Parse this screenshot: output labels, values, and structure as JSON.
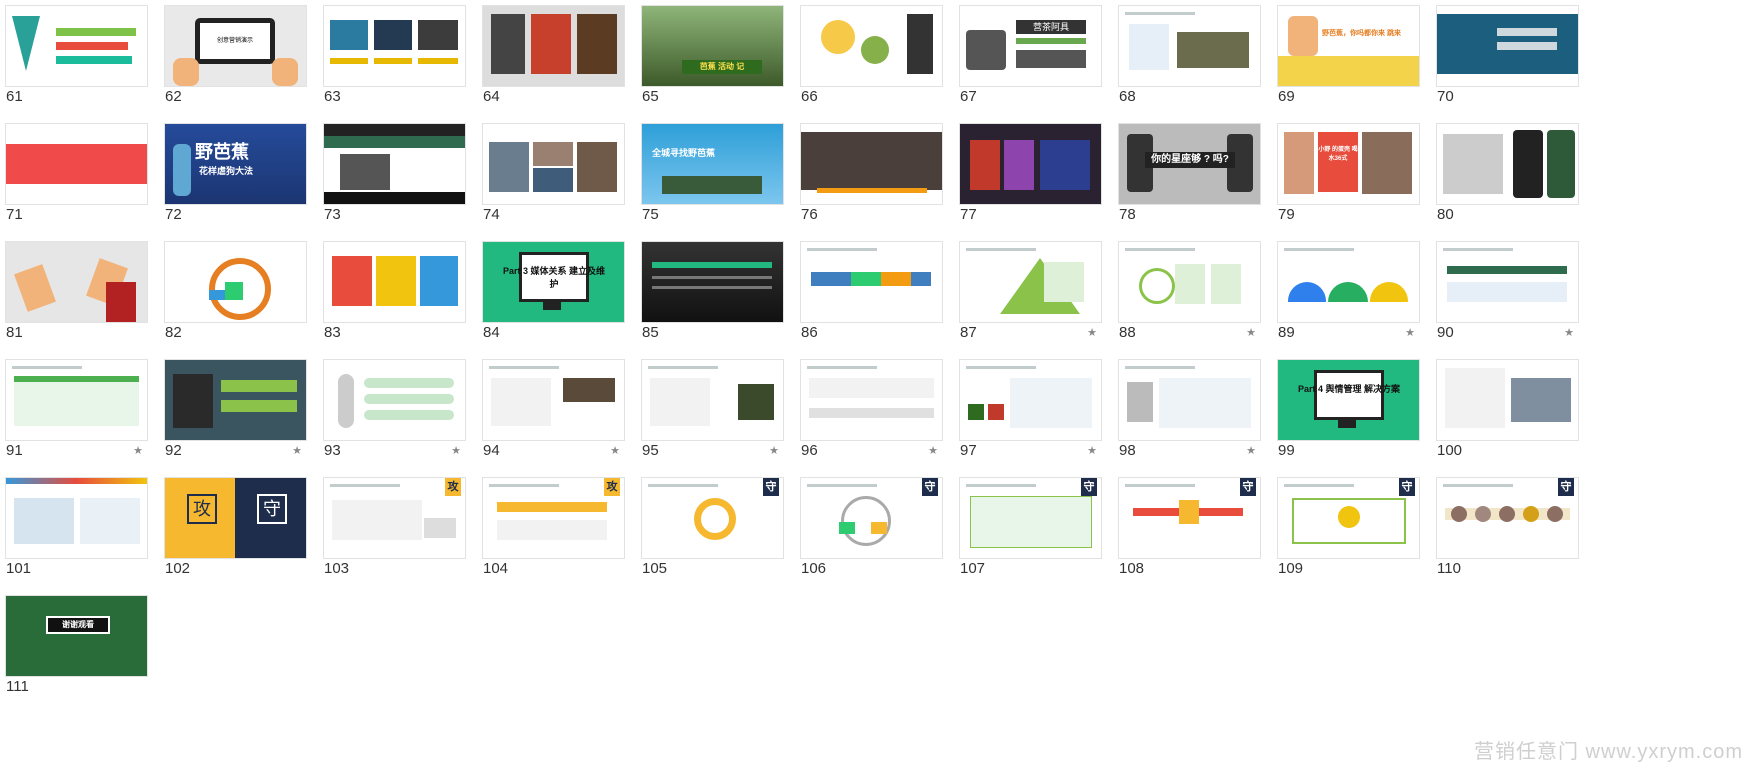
{
  "slides": [
    {
      "n": "61",
      "style": "tri",
      "star": false
    },
    {
      "n": "62",
      "style": "tablet",
      "text": "创意营销演示",
      "star": false
    },
    {
      "n": "63",
      "style": "flow3",
      "star": false
    },
    {
      "n": "64",
      "style": "food",
      "star": false
    },
    {
      "n": "65",
      "style": "landscape",
      "text": "芭蕉 活动 记",
      "star": false
    },
    {
      "n": "66",
      "style": "map",
      "star": false
    },
    {
      "n": "67",
      "style": "tea",
      "text": "营茶阿具",
      "star": false
    },
    {
      "n": "68",
      "style": "doc",
      "star": false
    },
    {
      "n": "69",
      "style": "yellow",
      "text": "野芭蕉，你吗都你来 跳来",
      "star": false
    },
    {
      "n": "70",
      "style": "bluepic",
      "star": false
    },
    {
      "n": "71",
      "style": "redbar",
      "star": false
    },
    {
      "n": "72",
      "style": "blueposter",
      "text": "野芭蕉",
      "sub": "花样虐狗大法",
      "star": false
    },
    {
      "n": "73",
      "style": "darkgreen",
      "star": false
    },
    {
      "n": "74",
      "style": "photos",
      "star": false
    },
    {
      "n": "75",
      "style": "plane",
      "text": "全城寻找野芭蕉",
      "star": false
    },
    {
      "n": "76",
      "style": "crowd",
      "star": false
    },
    {
      "n": "77",
      "style": "collage",
      "star": false
    },
    {
      "n": "78",
      "style": "phones",
      "text": "你的星座够 ? 吗?",
      "star": false
    },
    {
      "n": "79",
      "style": "people",
      "text": "小野 的蛋壳 喝水36式",
      "star": false
    },
    {
      "n": "80",
      "style": "phonesreal",
      "star": false
    },
    {
      "n": "81",
      "style": "hands",
      "star": false
    },
    {
      "n": "82",
      "style": "cycle",
      "star": false
    },
    {
      "n": "83",
      "style": "phonecolor",
      "star": false
    },
    {
      "n": "84",
      "style": "part",
      "text": "Part 3 媒体关系 建立及维护",
      "star": false
    },
    {
      "n": "85",
      "style": "citydark",
      "star": false
    },
    {
      "n": "86",
      "style": "arrows",
      "star": false
    },
    {
      "n": "87",
      "style": "pyramid",
      "star": true
    },
    {
      "n": "88",
      "style": "greenflow",
      "star": true
    },
    {
      "n": "89",
      "style": "semicircles",
      "star": true
    },
    {
      "n": "90",
      "style": "timeline",
      "star": true
    },
    {
      "n": "91",
      "style": "table",
      "star": true
    },
    {
      "n": "92",
      "style": "teamdark",
      "star": true
    },
    {
      "n": "93",
      "style": "figure",
      "star": true
    },
    {
      "n": "94",
      "style": "twocol",
      "star": true
    },
    {
      "n": "95",
      "style": "twocol2",
      "star": true
    },
    {
      "n": "96",
      "style": "logos",
      "star": true
    },
    {
      "n": "97",
      "style": "sheet",
      "star": true
    },
    {
      "n": "98",
      "style": "sheet2",
      "star": true
    },
    {
      "n": "99",
      "style": "part",
      "text": "Part 4 舆情管理 解决方案",
      "star": false
    },
    {
      "n": "100",
      "style": "textimg",
      "star": false
    },
    {
      "n": "101",
      "style": "screens",
      "star": false
    },
    {
      "n": "102",
      "style": "split",
      "text": "攻",
      "text2": "守",
      "star": false
    },
    {
      "n": "103",
      "style": "gong",
      "badge": "攻",
      "star": false
    },
    {
      "n": "104",
      "style": "gong2",
      "badge": "攻",
      "star": false
    },
    {
      "n": "105",
      "style": "ring",
      "badge": "守",
      "star": false
    },
    {
      "n": "106",
      "style": "circle3",
      "badge": "守",
      "star": false
    },
    {
      "n": "107",
      "style": "greenboxes",
      "badge": "守",
      "star": false
    },
    {
      "n": "108",
      "style": "steps",
      "badge": "守",
      "star": false
    },
    {
      "n": "109",
      "style": "bigarrow",
      "badge": "守",
      "star": false
    },
    {
      "n": "110",
      "style": "dots",
      "badge": "守",
      "star": false
    },
    {
      "n": "111",
      "style": "thanks",
      "text": "谢谢观看",
      "star": false
    }
  ],
  "watermark": "营销任意门 www.yxrym.com",
  "star_glyph": "★"
}
